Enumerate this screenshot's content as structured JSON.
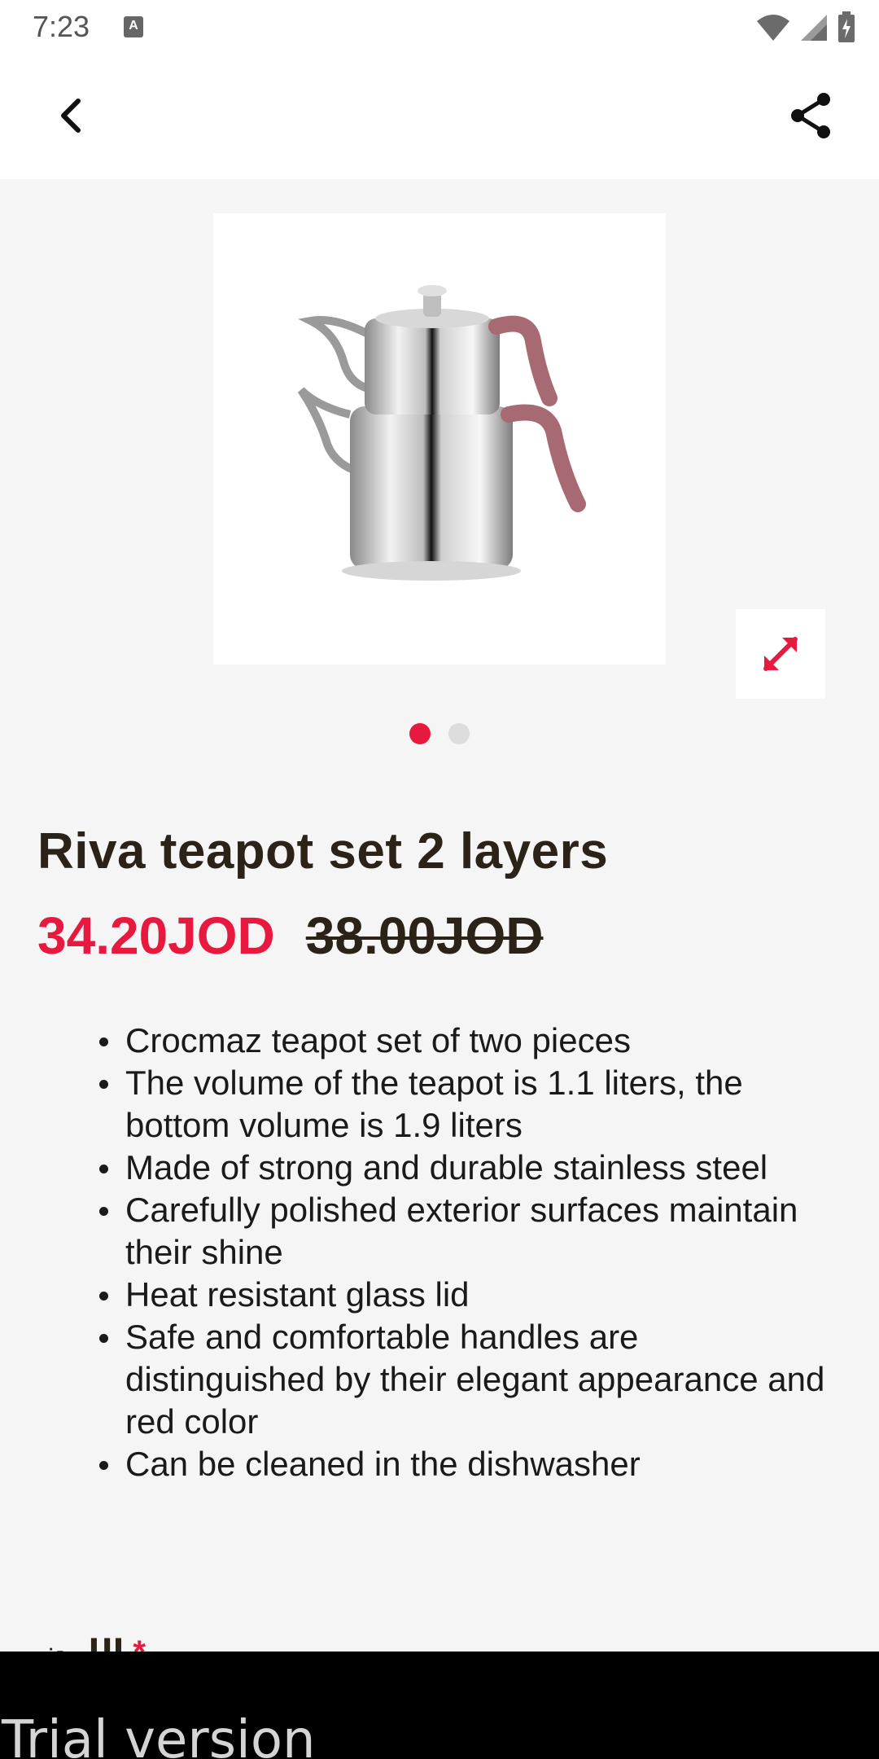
{
  "status_bar": {
    "time": "7:23",
    "notification_icon": "a-letter-icon",
    "icons": [
      "wifi-icon",
      "signal-icon",
      "battery-charging-icon"
    ]
  },
  "app_bar": {
    "back_icon": "chevron-left-icon",
    "share_icon": "share-icon"
  },
  "gallery": {
    "image_alt": "teapot-image",
    "expand_icon": "expand-arrows-icon",
    "page_count": 2,
    "active_page": 1,
    "accent_color": "#e8193f"
  },
  "product": {
    "title": "Riva teapot set 2 layers",
    "price_current": "34.20JOD",
    "price_old": "38.00JOD",
    "features": [
      "Crocmaz teapot set of two pieces",
      "The volume of the teapot is 1.1 liters, the bottom volume is 1.9 liters",
      "Made of strong and durable stainless steel",
      "Carefully polished exterior surfaces maintain their shine",
      "Heat resistant glass lid",
      "Safe and comfortable handles are distinguished by their elegant appearance and red color",
      "Can be cleaned in the dishwasher"
    ]
  },
  "partial_section": {
    "label": "اللون",
    "required_mark": "*"
  },
  "trial_banner": {
    "text": "Trial version"
  }
}
